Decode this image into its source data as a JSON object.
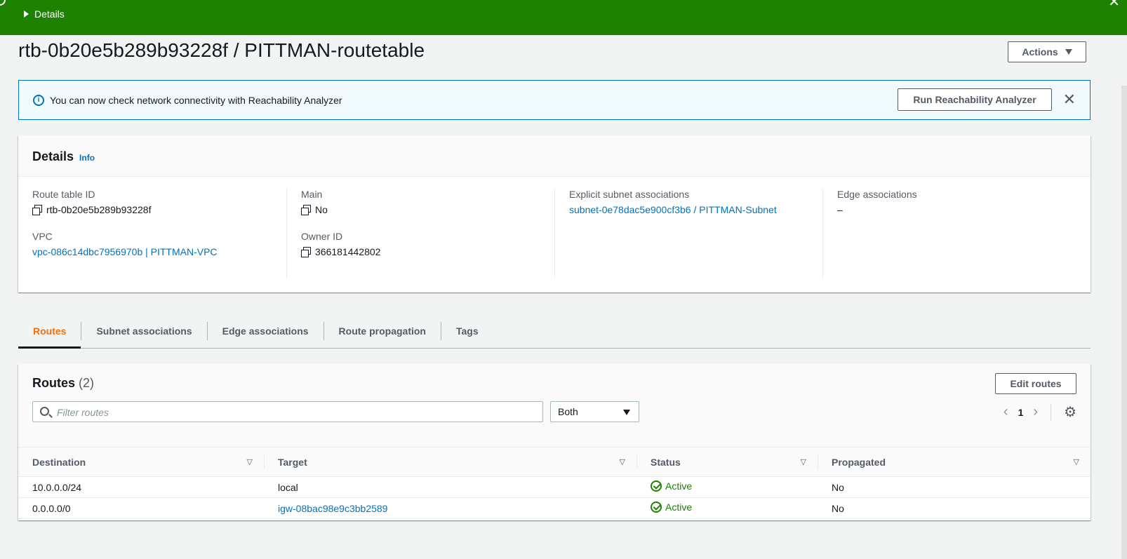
{
  "flash": {
    "details_label": "Details"
  },
  "page": {
    "title": "rtb-0b20e5b289b93228f / PITTMAN-routetable",
    "actions_label": "Actions"
  },
  "banner": {
    "message": "You can now check network connectivity with Reachability Analyzer",
    "button_label": "Run Reachability Analyzer"
  },
  "details": {
    "heading": "Details",
    "info_link": "Info",
    "route_table_id": {
      "label": "Route table ID",
      "value": "rtb-0b20e5b289b93228f"
    },
    "vpc": {
      "label": "VPC",
      "value": "vpc-086c14dbc7956970b | PITTMAN-VPC"
    },
    "main": {
      "label": "Main",
      "value": "No"
    },
    "owner_id": {
      "label": "Owner ID",
      "value": "366181442802"
    },
    "explicit_subnet": {
      "label": "Explicit subnet associations",
      "value": "subnet-0e78dac5e900cf3b6 / PITTMAN-Subnet"
    },
    "edge": {
      "label": "Edge associations",
      "value": "–"
    }
  },
  "tabs": [
    {
      "label": "Routes"
    },
    {
      "label": "Subnet associations"
    },
    {
      "label": "Edge associations"
    },
    {
      "label": "Route propagation"
    },
    {
      "label": "Tags"
    }
  ],
  "routes": {
    "heading": "Routes",
    "count": "(2)",
    "edit_label": "Edit routes",
    "filter_placeholder": "Filter routes",
    "select_value": "Both",
    "page": "1",
    "columns": [
      "Destination",
      "Target",
      "Status",
      "Propagated"
    ],
    "rows": [
      {
        "destination": "10.0.0.0/24",
        "target": "local",
        "status": "Active",
        "propagated": "No"
      },
      {
        "destination": "0.0.0.0/0",
        "target": "igw-08bac98e9c3bb2589",
        "status": "Active",
        "propagated": "No"
      }
    ]
  },
  "colors": {
    "flash_green": "#1d8102",
    "link": "#0073bb",
    "tab_active": "#ec7211",
    "status_ok": "#1d8102"
  }
}
